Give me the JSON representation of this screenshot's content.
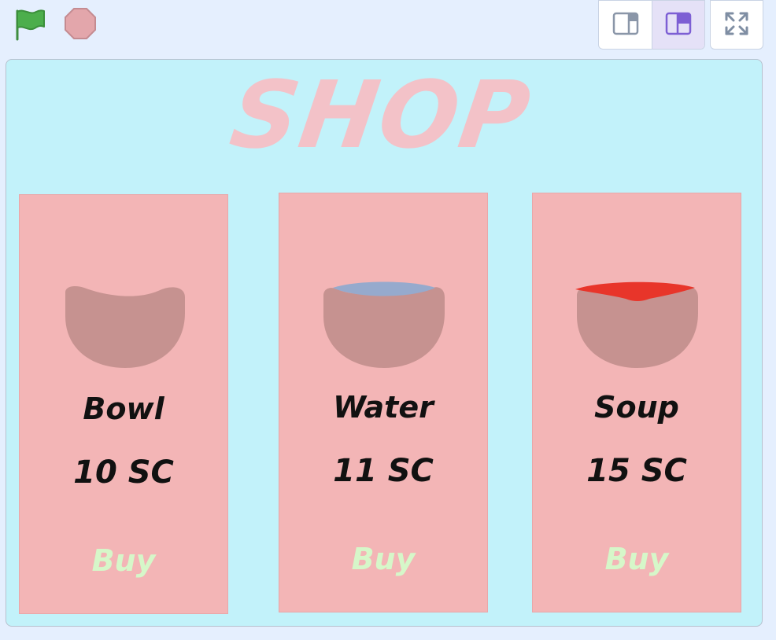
{
  "colors": {
    "background": "#e5effe",
    "stage": "#c2f2fa",
    "card": "#f3b5b6",
    "title": "#f3c2c8",
    "buy": "#d6f7c9",
    "bowl": "#c69290",
    "water": "#96aacd",
    "soup": "#e8352a",
    "flag": "#4cae4c",
    "stop": "#e3a6ab",
    "layout_active": "#7d5fd4"
  },
  "toolbar": {
    "green_flag_icon": "green-flag-icon",
    "stop_icon": "stop-sign-icon",
    "small_stage_icon": "small-stage-layout-icon",
    "normal_stage_icon": "normal-stage-layout-icon",
    "fullscreen_icon": "fullscreen-icon"
  },
  "stage": {
    "title": "SHOP",
    "items": [
      {
        "name": "Bowl",
        "price": "10 SC",
        "buy_label": "Buy",
        "contents": "empty"
      },
      {
        "name": "Water",
        "price": "11 SC",
        "buy_label": "Buy",
        "contents": "water"
      },
      {
        "name": "Soup",
        "price": "15 SC",
        "buy_label": "Buy",
        "contents": "soup"
      }
    ]
  }
}
